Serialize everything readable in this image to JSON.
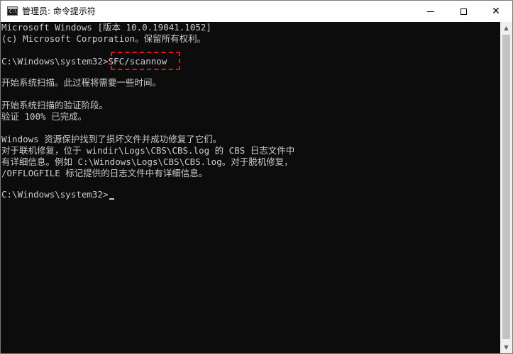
{
  "window": {
    "title": "管理员: 命令提示符",
    "icon_label": "C:\\",
    "controls": {
      "minimize": "minimize-icon",
      "maximize": "maximize-icon",
      "close": "✕"
    }
  },
  "console": {
    "lines": [
      "Microsoft Windows [版本 10.0.19041.1052]",
      "(c) Microsoft Corporation。保留所有权利。",
      "",
      "C:\\Windows\\system32>SFC/scannow",
      "",
      "开始系统扫描。此过程将需要一些时间。",
      "",
      "开始系统扫描的验证阶段。",
      "验证 100% 已完成。",
      "",
      "Windows 资源保护找到了损坏文件并成功修复了它们。",
      "对于联机修复，位于 windir\\Logs\\CBS\\CBS.log 的 CBS 日志文件中",
      "有详细信息。例如 C:\\Windows\\Logs\\CBS\\CBS.log。对于脱机修复，",
      "/OFFLOGFILE 标记提供的日志文件中有详细信息。",
      "",
      "C:\\Windows\\system32>"
    ],
    "highlight_color": "#e81123",
    "background_color": "#0c0c0c",
    "text_color": "#cccccc"
  },
  "scrollbar": {
    "up_arrow": "▲",
    "down_arrow": "▼"
  }
}
